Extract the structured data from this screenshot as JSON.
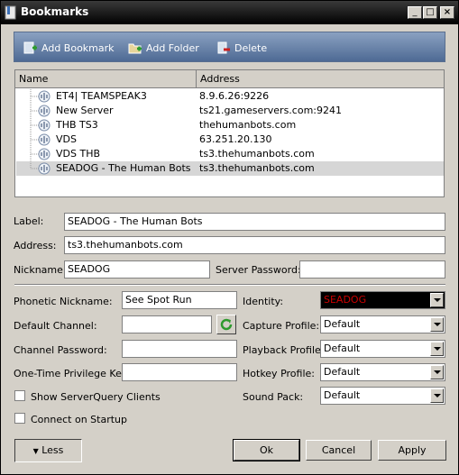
{
  "window": {
    "title": "Bookmarks"
  },
  "toolbar": {
    "add_bookmark": "Add Bookmark",
    "add_folder": "Add Folder",
    "delete": "Delete"
  },
  "list": {
    "columns": [
      "Name",
      "Address"
    ],
    "rows": [
      {
        "name": "ET4| TEAMSPEAK3",
        "address": "8.9.6.26:9226"
      },
      {
        "name": "New Server",
        "address": "ts21.gameservers.com:9241"
      },
      {
        "name": "THB TS3",
        "address": "thehumanbots.com"
      },
      {
        "name": "VDS",
        "address": "63.251.20.130"
      },
      {
        "name": "VDS THB",
        "address": "ts3.thehumanbots.com"
      },
      {
        "name": "SEADOG - The Human Bots",
        "address": "ts3.thehumanbots.com",
        "selected": true
      }
    ]
  },
  "form": {
    "label_label": "Label:",
    "label_value": "SEADOG - The Human Bots",
    "address_label": "Address:",
    "address_value": "ts3.thehumanbots.com",
    "nickname_label": "Nickname:",
    "nickname_value": "SEADOG",
    "server_password_label": "Server Password:",
    "server_password_value": "",
    "phonetic_label": "Phonetic Nickname:",
    "phonetic_value": "See Spot Run",
    "identity_label": "Identity:",
    "identity_value": "SEADOG",
    "default_channel_label": "Default Channel:",
    "default_channel_value": "",
    "capture_label": "Capture Profile:",
    "capture_value": "Default",
    "channel_password_label": "Channel Password:",
    "channel_password_value": "",
    "playback_label": "Playback Profile:",
    "playback_value": "Default",
    "privilege_label": "One-Time Privilege Key:",
    "privilege_value": "",
    "hotkey_label": "Hotkey Profile:",
    "hotkey_value": "Default",
    "serverquery_label": "Show ServerQuery Clients",
    "soundpack_label": "Sound Pack:",
    "soundpack_value": "Default",
    "connect_label": "Connect on Startup"
  },
  "buttons": {
    "less": "Less",
    "ok": "Ok",
    "cancel": "Cancel",
    "apply": "Apply"
  },
  "colors": {
    "identity_bg": "#000000",
    "identity_text": "#cc0000",
    "toolbar": "#5d7aa3"
  }
}
